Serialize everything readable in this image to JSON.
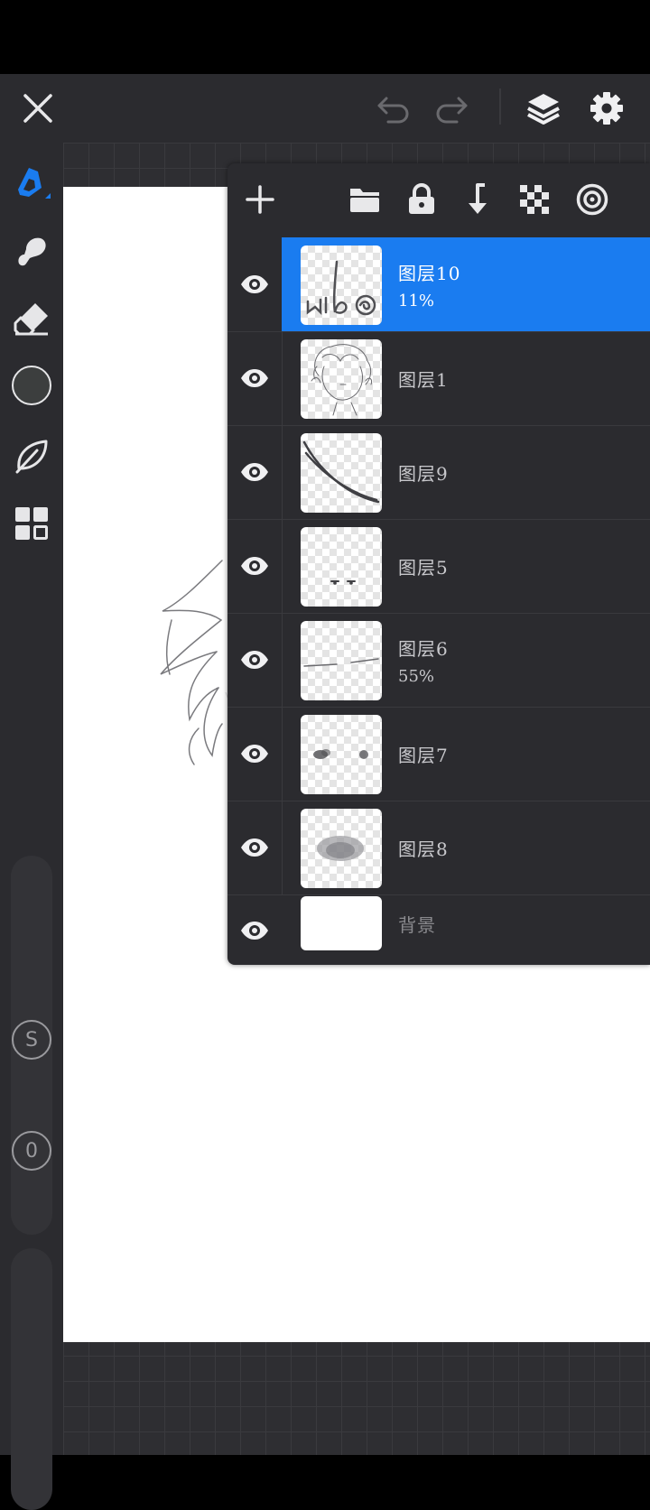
{
  "toolbar": {
    "close_icon": "close-icon",
    "undo_icon": "undo-icon",
    "redo_icon": "redo-icon",
    "layers_icon": "layers-icon",
    "settings_icon": "gear-icon"
  },
  "sidebar": {
    "tools": [
      "brush-tool-icon",
      "smudge-tool-icon",
      "eraser-tool-icon",
      "color-swatch",
      "leaf-icon",
      "grid-icon"
    ],
    "color": "#3c3e3e",
    "size_badge": "S",
    "opacity_badge": "0"
  },
  "layers_panel": {
    "tools": [
      "add-icon",
      "folder-icon",
      "lock-icon",
      "merge-down-icon",
      "alpha-lock-icon",
      "mask-icon"
    ],
    "layers": [
      {
        "name": "图层10",
        "opacity": "11%",
        "selected": true
      },
      {
        "name": "图层1",
        "opacity": "",
        "selected": false
      },
      {
        "name": "图层9",
        "opacity": "",
        "selected": false
      },
      {
        "name": "图层5",
        "opacity": "",
        "selected": false
      },
      {
        "name": "图层6",
        "opacity": "55%",
        "selected": false
      },
      {
        "name": "图层7",
        "opacity": "",
        "selected": false
      },
      {
        "name": "图层8",
        "opacity": "",
        "selected": false
      },
      {
        "name": "背景",
        "opacity": "",
        "selected": false
      }
    ]
  },
  "colors": {
    "accent": "#1a7cf0",
    "toolbar_bg": "#2b2b2f",
    "workspace_bg": "#2e2e32"
  }
}
